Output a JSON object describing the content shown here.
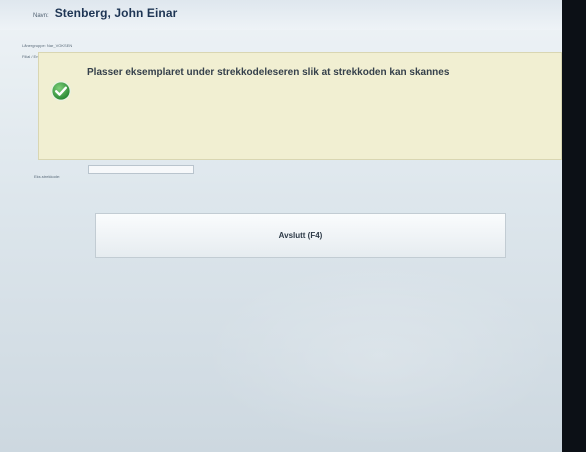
{
  "header": {
    "name_label": "Navn:",
    "name_value": "Stenberg, John Einar"
  },
  "meta": {
    "group": "Lånergruppe: Nar_VOKSEN",
    "branch": "Filial / Enhet: Karlsøy folkebibliotek"
  },
  "message": {
    "icon": "check-circle-icon",
    "text": "Plasser eksemplaret under strekkodeleseren slik at strekkoden kan skannes"
  },
  "scan": {
    "label": "Eks.strekkode:",
    "value": ""
  },
  "actions": {
    "finish_label": "Avslutt (F4)"
  },
  "colors": {
    "panel": "#f1efd2",
    "accent_green": "#2f9a3a"
  }
}
